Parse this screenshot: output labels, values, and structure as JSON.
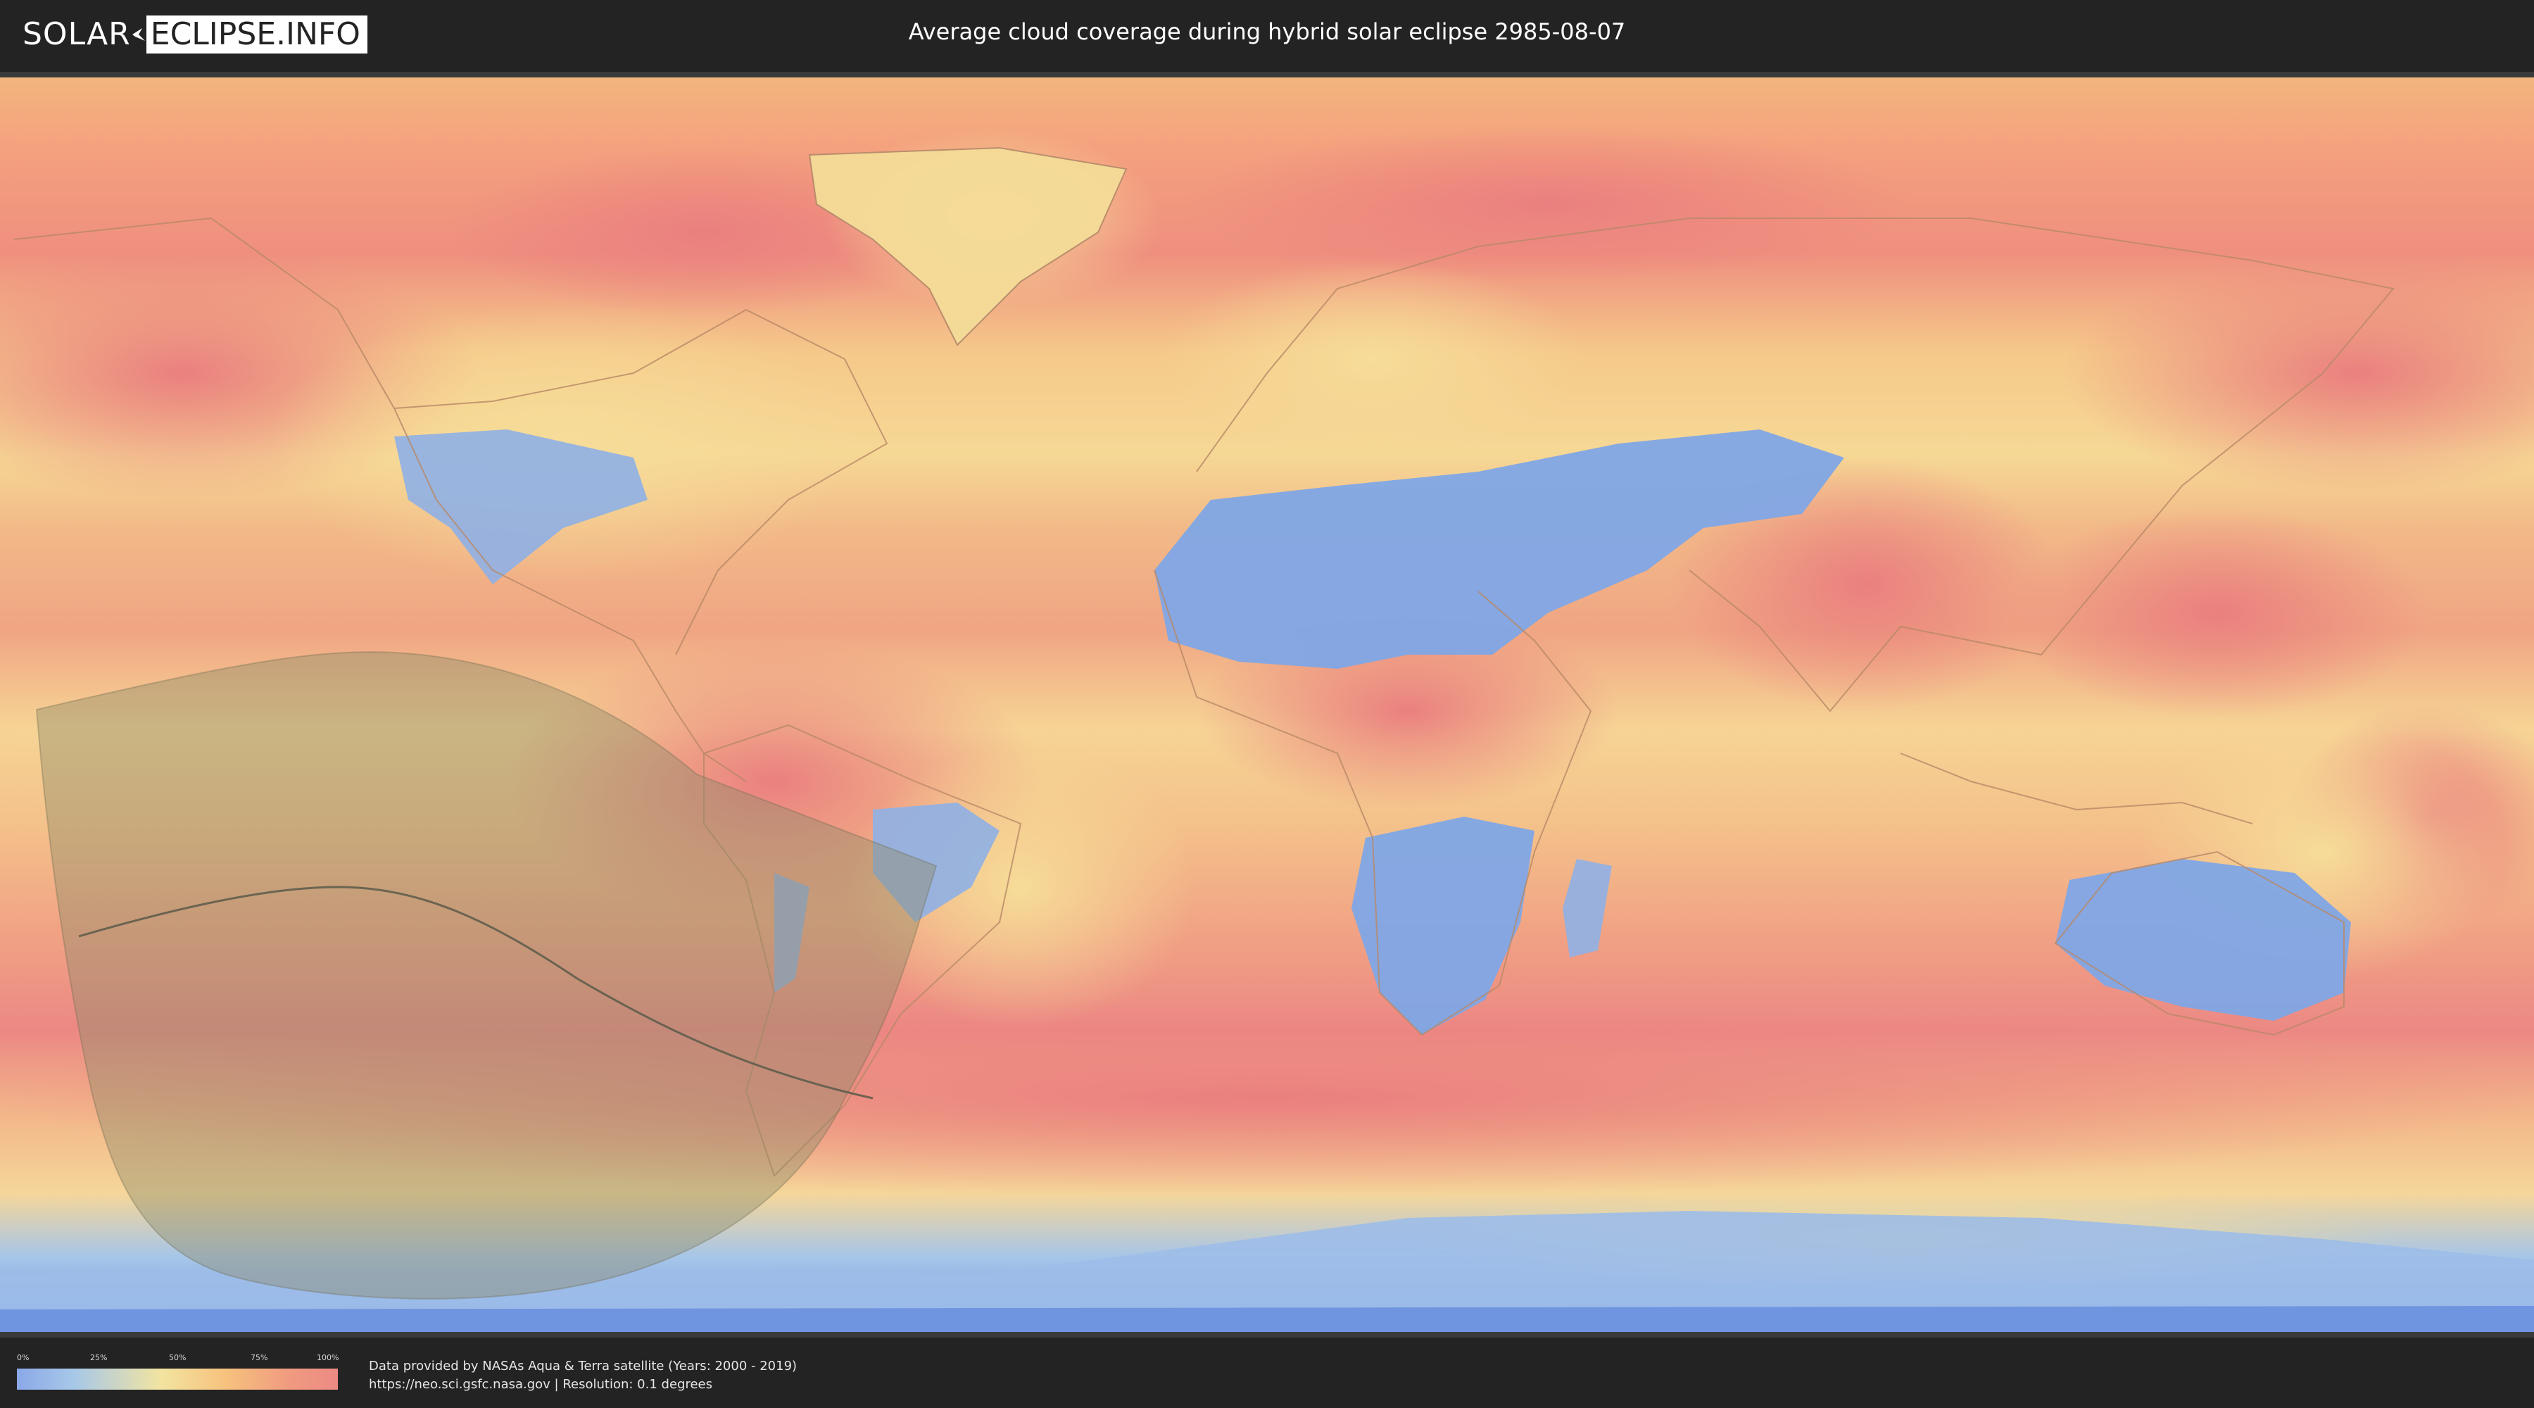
{
  "header": {
    "logo_left": "SOLAR",
    "logo_right": "ECLIPSE.INFO",
    "title": "Average cloud coverage during hybrid solar eclipse 2985-08-07"
  },
  "colors": {
    "header_bg": "#232323",
    "cloud_low": "#7fa6e8",
    "cloud_mid": "#f3dc96",
    "cloud_high": "#ec8883",
    "eclipse_zone": "#8c8a6a",
    "central_line": "#5a5a4a"
  },
  "legend": {
    "ticks": [
      "0%",
      "25%",
      "50%",
      "75%",
      "100%"
    ]
  },
  "footer": {
    "credit_line_1": "Data provided by NASAs Aqua & Terra satellite (Years: 2000 - 2019)",
    "credit_line_2": "https://neo.sci.gsfc.nasa.gov | Resolution: 0.1 degrees"
  }
}
